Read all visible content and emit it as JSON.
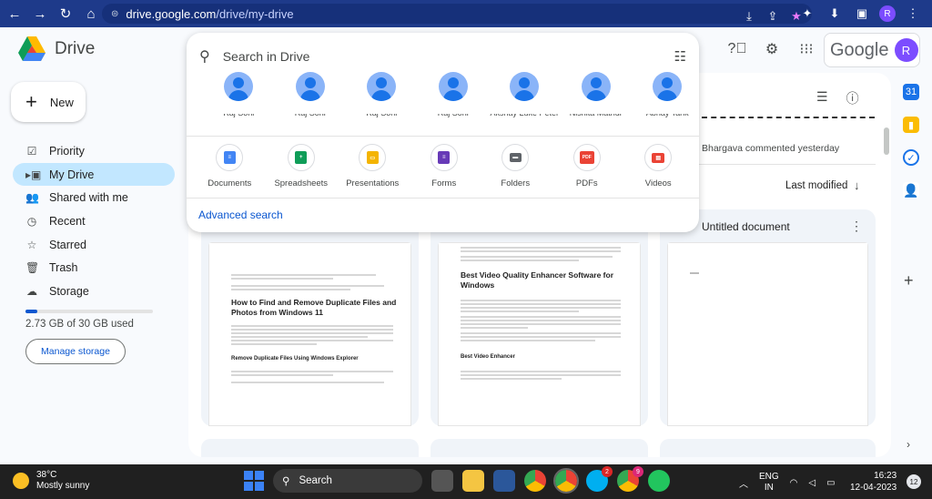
{
  "browser": {
    "url_host": "drive.google.com",
    "url_path": "/drive/my-drive",
    "profile_initial": "R"
  },
  "header": {
    "app_name": "Drive",
    "brand_word": "Google",
    "account_initial": "R"
  },
  "sidebar": {
    "new_label": "New",
    "items": [
      {
        "label": "Priority",
        "icon": "priority-icon"
      },
      {
        "label": "My Drive",
        "icon": "drive-icon",
        "active": true
      },
      {
        "label": "Shared with me",
        "icon": "people-icon"
      },
      {
        "label": "Recent",
        "icon": "clock-icon"
      },
      {
        "label": "Starred",
        "icon": "star-icon"
      },
      {
        "label": "Trash",
        "icon": "trash-icon"
      },
      {
        "label": "Storage",
        "icon": "cloud-icon"
      }
    ],
    "storage_used": "2.73 GB of 30 GB used",
    "storage_fraction": 0.091,
    "manage_label": "Manage storage"
  },
  "search": {
    "placeholder": "Search in Drive",
    "people": [
      {
        "name": "Raj Soni"
      },
      {
        "name": "Raj Soni"
      },
      {
        "name": "Raj Soni"
      },
      {
        "name": "Raj Soni"
      },
      {
        "name": "Akshay Luke Peter"
      },
      {
        "name": "Nishita Mathur"
      },
      {
        "name": "Abhay Tank"
      }
    ],
    "types": [
      {
        "label": "Documents",
        "color": "#4285f4",
        "glyph": "≡"
      },
      {
        "label": "Spreadsheets",
        "color": "#0f9d58",
        "glyph": "+"
      },
      {
        "label": "Presentations",
        "color": "#f4b400",
        "glyph": "▭"
      },
      {
        "label": "Forms",
        "color": "#673ab7",
        "glyph": "≡"
      },
      {
        "label": "Folders",
        "color": "#5f6368",
        "glyph": "▬"
      },
      {
        "label": "PDFs",
        "color": "#ea4335",
        "glyph": "PDF"
      },
      {
        "label": "Videos",
        "color": "#ea4335",
        "glyph": "▤"
      }
    ],
    "advanced_label": "Advanced search"
  },
  "main": {
    "comment": "Bhargava commented yesterday",
    "sort_label": "Last modified",
    "cards": [
      {
        "title": "",
        "doc_heading": "How to Find and Remove Duplicate Files and Photos from Windows 11",
        "section": "Remove Duplicate Files Using Windows Explorer"
      },
      {
        "title": "",
        "doc_heading": "Best Video Quality Enhancer Software for Windows",
        "section": "Best Video Enhancer"
      },
      {
        "title": "Untitled document",
        "doc_heading": "",
        "section": ""
      }
    ]
  },
  "taskbar": {
    "temp": "38°C",
    "weather": "Mostly sunny",
    "search_label": "Search",
    "lang_top": "ENG",
    "lang_bottom": "IN",
    "time": "16:23",
    "date": "12-04-2023",
    "notif_count": "12",
    "badge_a": "2",
    "badge_b": "9"
  }
}
